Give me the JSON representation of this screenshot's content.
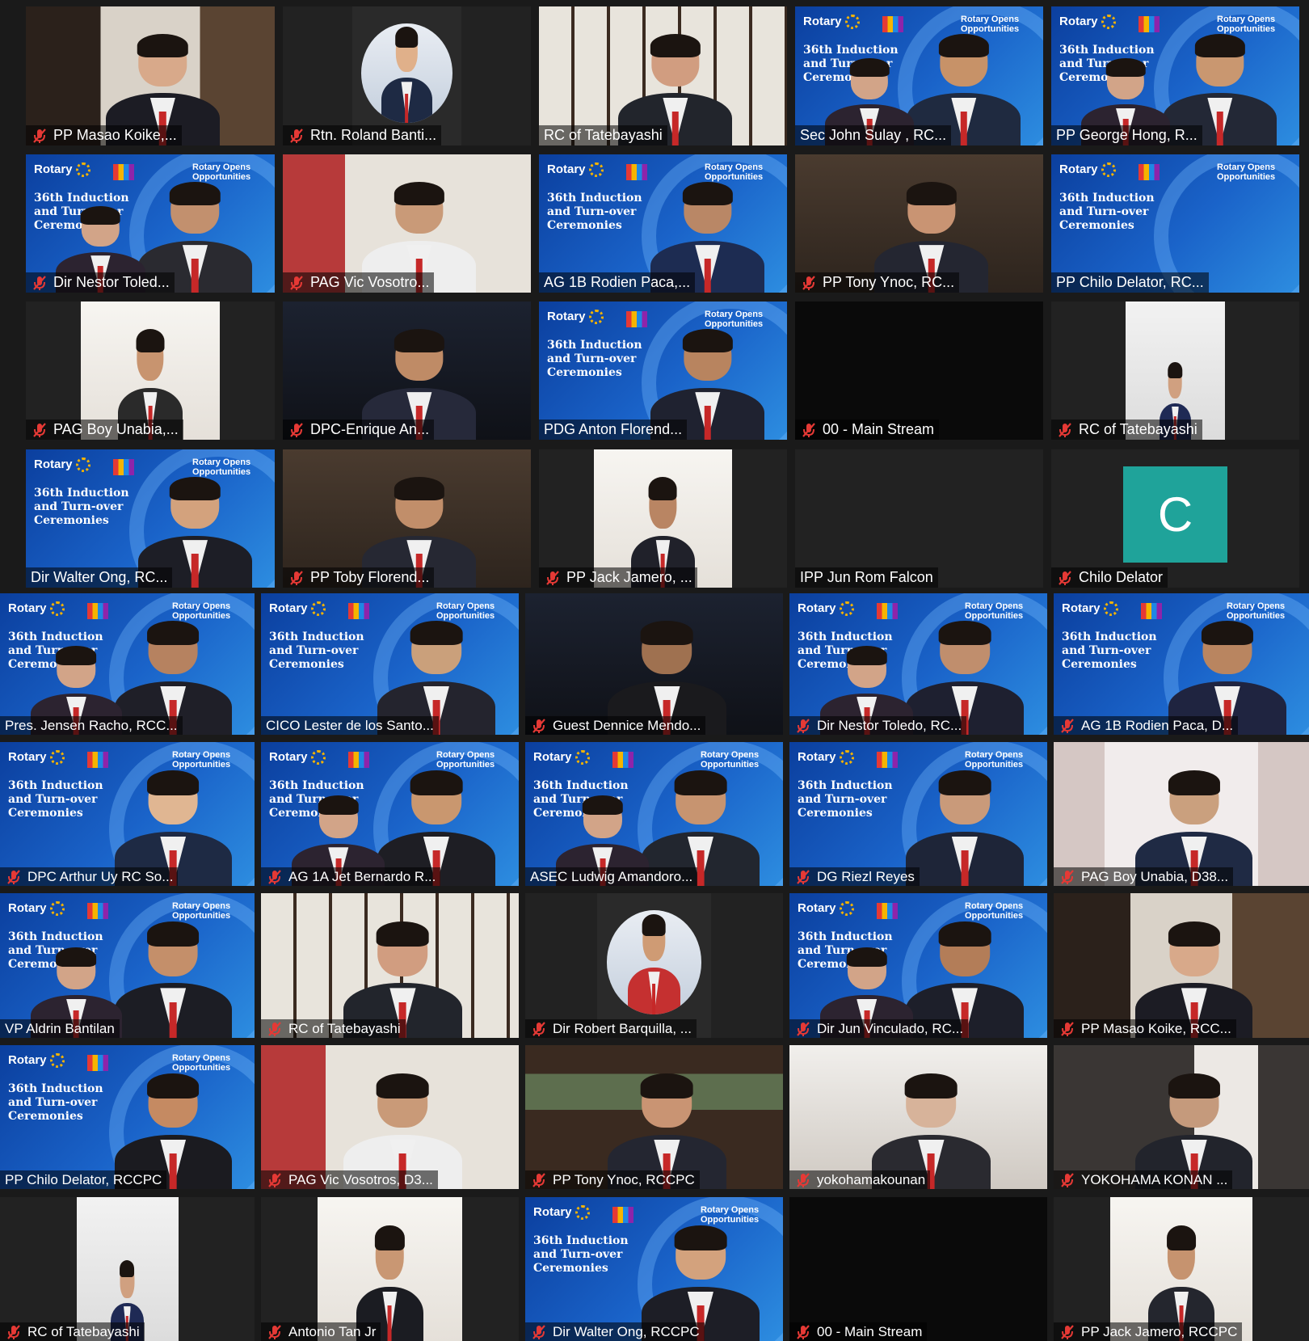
{
  "meeting": {
    "backdrop": {
      "brand": "Rotary",
      "opportunities": "Rotary Opens Opportunities",
      "title": "36th Induction and Turn-over Ceremonies"
    },
    "participants": [
      {
        "name": "PP Masao Koike,...",
        "muted": true
      },
      {
        "name": "Rtn. Roland Banti...",
        "muted": true
      },
      {
        "name": "RC of Tatebayashi",
        "muted": false
      },
      {
        "name": "Sec John Sulay , RC...",
        "muted": false
      },
      {
        "name": "PP George Hong, R...",
        "muted": false
      },
      {
        "name": "Dir Nestor Toled...",
        "muted": true
      },
      {
        "name": "PAG Vic Vosotro...",
        "muted": true
      },
      {
        "name": "AG 1B Rodien Paca,...",
        "muted": false
      },
      {
        "name": "PP Tony Ynoc, RC...",
        "muted": true
      },
      {
        "name": "PP Chilo Delator, RC...",
        "muted": false
      },
      {
        "name": "PAG Boy Unabia,...",
        "muted": true
      },
      {
        "name": "DPC-Enrique An...",
        "muted": true
      },
      {
        "name": "PDG Anton Florend...",
        "muted": false
      },
      {
        "name": "00 - Main Stream",
        "muted": true
      },
      {
        "name": "RC of Tatebayashi",
        "muted": true
      },
      {
        "name": "Dir Walter Ong, RC...",
        "muted": false
      },
      {
        "name": "PP Toby Florend...",
        "muted": true
      },
      {
        "name": "PP Jack Jamero, ...",
        "muted": true
      },
      {
        "name": "IPP Jun Rom Falcon",
        "muted": false
      },
      {
        "name": "Chilo Delator",
        "muted": true,
        "avatar_letter": "C"
      },
      {
        "name": "Pres. Jensen Racho, RCC...",
        "muted": false
      },
      {
        "name": "CICO Lester de los Santo...",
        "muted": false
      },
      {
        "name": "Guest Dennice Mendo...",
        "muted": true
      },
      {
        "name": "Dir Nestor Toledo, RC...",
        "muted": true
      },
      {
        "name": "AG 1B Rodien Paca, D...",
        "muted": true
      },
      {
        "name": "DPC Arthur Uy RC So...",
        "muted": true
      },
      {
        "name": "AG 1A Jet Bernardo R...",
        "muted": true
      },
      {
        "name": "ASEC Ludwig Amandoro...",
        "muted": false
      },
      {
        "name": "DG Riezl Reyes",
        "muted": true
      },
      {
        "name": "PAG Boy Unabia, D38...",
        "muted": true
      },
      {
        "name": "VP Aldrin Bantilan",
        "muted": false
      },
      {
        "name": "RC of Tatebayashi",
        "muted": true
      },
      {
        "name": "Dir Robert Barquilla, ...",
        "muted": true
      },
      {
        "name": "Dir Jun Vinculado, RC...",
        "muted": true
      },
      {
        "name": "PP Masao Koike, RCC...",
        "muted": true
      },
      {
        "name": "PP Chilo Delator, RCCPC",
        "muted": false
      },
      {
        "name": "PAG Vic Vosotros, D3...",
        "muted": true
      },
      {
        "name": "PP Tony Ynoc, RCCPC",
        "muted": true
      },
      {
        "name": "yokohamakounan",
        "muted": true
      },
      {
        "name": "YOKOHAMA KONAN ...",
        "muted": true
      },
      {
        "name": "RC of Tatebayashi",
        "muted": true
      },
      {
        "name": "Antonio Tan Jr",
        "muted": true
      },
      {
        "name": "Dir Walter Ong, RCCPC",
        "muted": true
      },
      {
        "name": "00 - Main Stream",
        "muted": true
      },
      {
        "name": "PP Jack Jamero, RCCPC",
        "muted": true
      }
    ],
    "active_speaker_index": 20
  }
}
